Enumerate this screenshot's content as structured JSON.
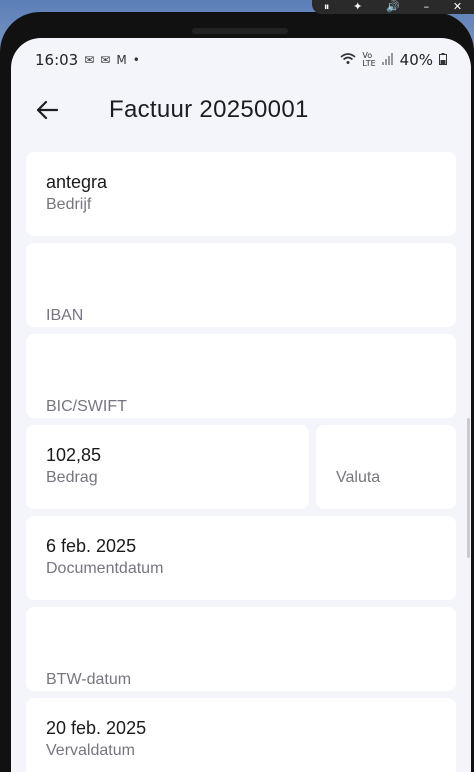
{
  "statusbar": {
    "time": "16:03",
    "notification_icons": [
      "mail-icon",
      "mail-icon",
      "gmail-icon",
      "dot-icon"
    ],
    "battery": "40%"
  },
  "appbar": {
    "title": "Factuur 20250001"
  },
  "fields": {
    "company": {
      "value": "antegra",
      "label": "Bedrijf"
    },
    "iban": {
      "value": "",
      "label": "IBAN"
    },
    "bic": {
      "value": "",
      "label": "BIC/SWIFT"
    },
    "amount": {
      "value": "102,85",
      "label": "Bedrag"
    },
    "currency": {
      "value": "",
      "label": "Valuta"
    },
    "document_date": {
      "value": "6 feb. 2025",
      "label": "Documentdatum"
    },
    "vat_date": {
      "value": "",
      "label": "BTW-datum"
    },
    "due_date": {
      "value": "20 feb. 2025",
      "label": "Vervaldatum"
    }
  }
}
